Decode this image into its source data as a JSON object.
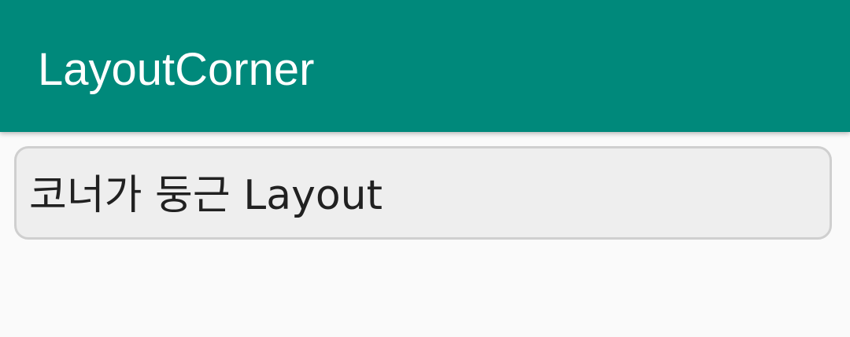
{
  "app_bar": {
    "title": "LayoutCorner",
    "color": "#00897b"
  },
  "content": {
    "rounded_layout": {
      "text": "코너가 둥근 Layout",
      "background": "#eeeeee",
      "border_color": "#cfcfcf"
    }
  }
}
